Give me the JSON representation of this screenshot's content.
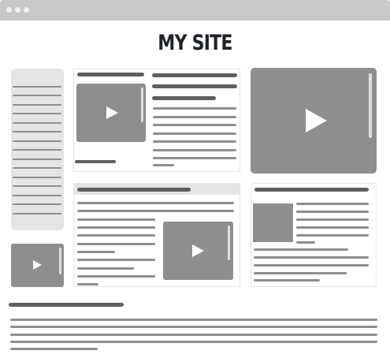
{
  "window": {
    "controls": [
      "window-dot-1",
      "window-dot-2",
      "window-dot-3"
    ]
  },
  "site": {
    "title": "MY SITE"
  },
  "icons": {
    "play": "play-icon"
  },
  "colors": {
    "window_chrome": "#c8c9cb",
    "placeholder_gray": "#8e8e90",
    "placeholder_dark": "#5f5f61",
    "title_text": "#1f2327",
    "panel_fill": "#e5e5e6"
  }
}
